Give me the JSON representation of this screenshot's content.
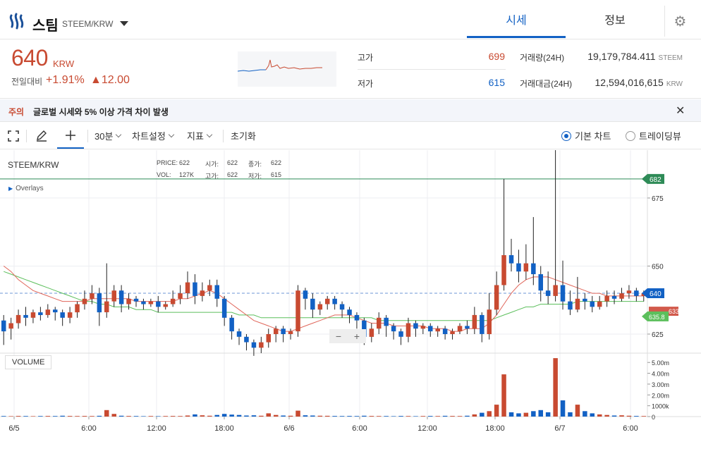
{
  "header": {
    "coin_name": "스팀",
    "pair": "STEEM/KRW",
    "tabs": [
      {
        "label": "시세",
        "active": true
      },
      {
        "label": "정보",
        "active": false
      }
    ],
    "settings_icon": "gear-icon"
  },
  "summary": {
    "price": "640",
    "unit": "KRW",
    "change_label": "전일대비",
    "change_pct": "+1.91%",
    "change_abs": "▲12.00",
    "high_label": "고가",
    "high": "699",
    "low_label": "저가",
    "low": "615",
    "volume_label": "거래량(24H)",
    "volume": "19,179,784.411",
    "volume_unit": "STEEM",
    "amount_label": "거래대금(24H)",
    "amount": "12,594,016,615",
    "amount_unit": "KRW"
  },
  "notice": {
    "tag": "주의",
    "text": "글로벌 시세와 5% 이상 가격 차이 발생"
  },
  "toolbar": {
    "interval": "30분",
    "chart_settings": "차트설정",
    "indicators": "지표",
    "reset": "초기화",
    "mode_basic": "기본 차트",
    "mode_trading": "트레이딩뷰"
  },
  "chart": {
    "title": "STEEM/KRW",
    "ohlc": {
      "price_label": "PRICE:",
      "price": "622",
      "open_label": "시가:",
      "open": "622",
      "close_label": "종가:",
      "close": "622",
      "vol_label": "VOL:",
      "vol": "127K",
      "high_label": "고가:",
      "high": "622",
      "low_label": "저가:",
      "low": "615"
    },
    "overlays_label": "Overlays",
    "volume_label": "VOLUME",
    "zoom_out": "−",
    "zoom_in": "+",
    "price_ticks": [
      "675",
      "650",
      "625"
    ],
    "volume_ticks": [
      "5.00m",
      "4.00m",
      "3.00m",
      "2.00m",
      "1000k",
      "0"
    ],
    "time_ticks": [
      "6/5",
      "6:00",
      "12:00",
      "18:00",
      "6/6",
      "6:00",
      "12:00",
      "18:00",
      "6/7",
      "6:00"
    ],
    "markers": {
      "line_682": "682",
      "current": "640",
      "red_tag": "633",
      "green_tag": "635.8"
    },
    "colors": {
      "up": "#c84a31",
      "down": "#1261c4",
      "ma_red": "#e0665a",
      "ma_green": "#5cbf5c",
      "hline": "#2e8b57"
    }
  },
  "chart_data": {
    "type": "candlestick",
    "y_range": [
      618,
      690
    ],
    "price_range": [
      618,
      690
    ],
    "candles": [
      [
        630,
        626,
        621,
        632
      ],
      [
        627,
        629,
        623,
        631
      ],
      [
        629,
        632,
        627,
        634
      ],
      [
        632,
        631,
        628,
        635
      ],
      [
        631,
        633,
        629,
        634
      ],
      [
        633,
        632,
        630,
        635
      ],
      [
        632,
        634,
        631,
        636
      ],
      [
        634,
        633,
        630,
        635
      ],
      [
        633,
        631,
        628,
        634
      ],
      [
        631,
        633,
        629,
        635
      ],
      [
        633,
        636,
        631,
        637
      ],
      [
        636,
        638,
        634,
        641
      ],
      [
        638,
        640,
        636,
        643
      ],
      [
        640,
        633,
        628,
        642
      ],
      [
        633,
        637,
        631,
        651
      ],
      [
        637,
        641,
        635,
        643
      ],
      [
        641,
        636,
        633,
        643
      ],
      [
        636,
        638,
        634,
        640
      ],
      [
        638,
        637,
        635,
        639
      ],
      [
        637,
        636,
        634,
        638
      ],
      [
        636,
        637,
        635,
        638
      ],
      [
        637,
        635,
        633,
        639
      ],
      [
        635,
        636,
        634,
        637
      ],
      [
        636,
        638,
        635,
        641
      ],
      [
        638,
        640,
        636,
        643
      ],
      [
        640,
        644,
        638,
        648
      ],
      [
        644,
        639,
        636,
        647
      ],
      [
        639,
        641,
        637,
        644
      ],
      [
        641,
        643,
        639,
        645
      ],
      [
        643,
        638,
        635,
        645
      ],
      [
        638,
        631,
        628,
        639
      ],
      [
        631,
        626,
        623,
        632
      ],
      [
        626,
        624,
        621,
        627
      ],
      [
        624,
        622,
        619,
        625
      ],
      [
        622,
        620,
        617,
        623
      ],
      [
        620,
        622,
        618,
        624
      ],
      [
        622,
        625,
        620,
        627
      ],
      [
        625,
        627,
        622,
        628
      ],
      [
        627,
        625,
        622,
        628
      ],
      [
        625,
        626,
        623,
        627
      ],
      [
        626,
        641,
        624,
        643
      ],
      [
        641,
        638,
        634,
        642
      ],
      [
        638,
        634,
        631,
        640
      ],
      [
        634,
        636,
        632,
        637
      ],
      [
        636,
        638,
        634,
        639
      ],
      [
        638,
        636,
        634,
        639
      ],
      [
        636,
        634,
        631,
        637
      ],
      [
        634,
        632,
        629,
        635
      ],
      [
        632,
        630,
        627,
        633
      ],
      [
        630,
        624,
        621,
        631
      ],
      [
        624,
        627,
        622,
        629
      ],
      [
        627,
        631,
        625,
        633
      ],
      [
        631,
        628,
        624,
        632
      ],
      [
        628,
        626,
        623,
        629
      ],
      [
        626,
        624,
        621,
        627
      ],
      [
        624,
        629,
        622,
        631
      ],
      [
        629,
        627,
        624,
        630
      ],
      [
        627,
        628,
        625,
        629
      ],
      [
        628,
        626,
        624,
        629
      ],
      [
        626,
        627,
        624,
        628
      ],
      [
        627,
        625,
        623,
        628
      ],
      [
        625,
        626,
        623,
        627
      ],
      [
        626,
        628,
        625,
        629
      ],
      [
        628,
        627,
        625,
        630
      ],
      [
        627,
        632,
        625,
        635
      ],
      [
        632,
        625,
        622,
        633
      ],
      [
        625,
        634,
        623,
        640
      ],
      [
        634,
        643,
        632,
        648
      ],
      [
        643,
        654,
        641,
        682
      ],
      [
        654,
        651,
        648,
        660
      ],
      [
        651,
        648,
        644,
        656
      ],
      [
        648,
        651,
        645,
        658
      ],
      [
        651,
        647,
        643,
        668
      ],
      [
        647,
        641,
        637,
        650
      ],
      [
        641,
        639,
        636,
        648
      ],
      [
        639,
        643,
        637,
        695
      ],
      [
        643,
        637,
        634,
        652
      ],
      [
        637,
        634,
        632,
        641
      ],
      [
        634,
        638,
        633,
        646
      ],
      [
        638,
        637,
        634,
        640
      ],
      [
        637,
        635,
        633,
        639
      ],
      [
        635,
        637,
        634,
        639
      ],
      [
        637,
        639,
        635,
        641
      ],
      [
        639,
        638,
        636,
        641
      ],
      [
        638,
        640,
        637,
        642
      ],
      [
        640,
        641,
        638,
        643
      ],
      [
        641,
        639,
        637,
        642
      ],
      [
        639,
        640,
        637,
        641
      ]
    ],
    "volumes": [
      0.05,
      0.04,
      0.06,
      0.05,
      0.04,
      0.05,
      0.06,
      0.05,
      0.08,
      0.06,
      0.05,
      0.06,
      0.05,
      0.07,
      0.6,
      0.25,
      0.08,
      0.06,
      0.05,
      0.04,
      0.05,
      0.04,
      0.05,
      0.06,
      0.05,
      0.1,
      0.2,
      0.12,
      0.08,
      0.15,
      0.25,
      0.18,
      0.15,
      0.1,
      0.12,
      0.08,
      0.3,
      0.15,
      0.1,
      0.08,
      0.55,
      0.12,
      0.1,
      0.08,
      0.07,
      0.06,
      0.05,
      0.06,
      0.05,
      0.08,
      0.06,
      0.05,
      0.05,
      0.04,
      0.06,
      0.05,
      0.04,
      0.05,
      0.06,
      0.05,
      0.07,
      0.06,
      0.05,
      0.08,
      0.2,
      0.35,
      0.5,
      1.1,
      3.9,
      0.4,
      0.3,
      0.35,
      0.5,
      0.6,
      0.4,
      5.4,
      1.5,
      0.4,
      1.1,
      0.5,
      0.3,
      0.2,
      0.15,
      0.1,
      0.12,
      0.08,
      0.06,
      0.05
    ],
    "ma_red": [
      650,
      648,
      645,
      643,
      641,
      640,
      639,
      638,
      637,
      637,
      637,
      637,
      638,
      638,
      638,
      638,
      638,
      638,
      637,
      637,
      637,
      637,
      637,
      637,
      638,
      638,
      639,
      640,
      641,
      640,
      638,
      636,
      634,
      632,
      630,
      629,
      628,
      627,
      626,
      626,
      627,
      628,
      629,
      630,
      631,
      632,
      632,
      632,
      631,
      630,
      629,
      629,
      629,
      628,
      628,
      628,
      628,
      628,
      627,
      627,
      627,
      626,
      626,
      627,
      627,
      627,
      629,
      632,
      636,
      640,
      643,
      645,
      646,
      646,
      646,
      645,
      644,
      643,
      642,
      641,
      640,
      640,
      639,
      639,
      639,
      639,
      639,
      639
    ],
    "ma_green": [
      648,
      647,
      646,
      645,
      644,
      643,
      642,
      641,
      640,
      639,
      638,
      637,
      637,
      636,
      636,
      635,
      635,
      635,
      634,
      634,
      634,
      633,
      633,
      633,
      633,
      633,
      633,
      633,
      633,
      633,
      633,
      633,
      632,
      632,
      632,
      631,
      631,
      631,
      631,
      631,
      631,
      631,
      631,
      631,
      631,
      631,
      631,
      631,
      631,
      631,
      631,
      630,
      630,
      630,
      630,
      630,
      630,
      630,
      630,
      630,
      630,
      630,
      630,
      630,
      630,
      630,
      630,
      631,
      632,
      633,
      634,
      635,
      635,
      636,
      636,
      636,
      636,
      636,
      637,
      637,
      637,
      637,
      637,
      637,
      637,
      637,
      637,
      637
    ]
  }
}
